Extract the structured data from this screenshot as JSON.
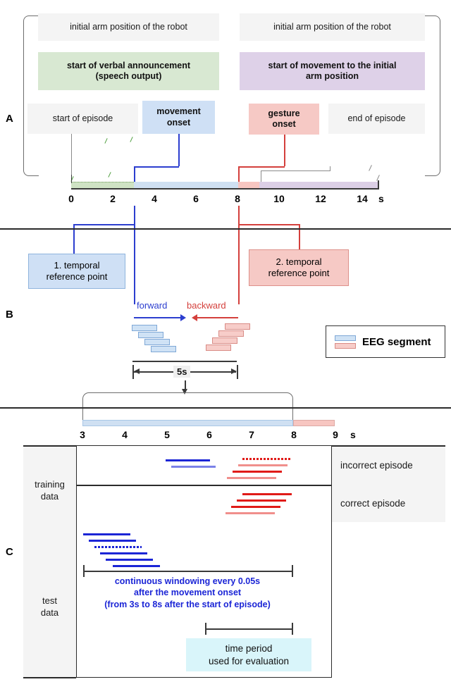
{
  "figure": {
    "panels": [
      {
        "letter": "A"
      },
      {
        "letter": "B"
      },
      {
        "letter": "C"
      }
    ]
  },
  "panel_a": {
    "boxes": {
      "initial_arm_left": "initial arm position of the robot",
      "initial_arm_right": "initial arm position of the robot",
      "speech": "start of verbal announcement\n(speech output)",
      "speech_line1": "start of verbal announcement",
      "speech_line2": "(speech output)",
      "movement_to_initial_line1": "start of movement to the initial",
      "movement_to_initial_line2": "arm position",
      "start_of_episode": "start of episode",
      "movement_onset_line1": "movement",
      "movement_onset_line2": "onset",
      "gesture_onset_line1": "gesture",
      "gesture_onset_line2": "onset",
      "end_of_episode": "end of episode"
    },
    "axis": {
      "ticks": [
        "0",
        "2",
        "4",
        "6",
        "8",
        "10",
        "12",
        "14"
      ],
      "tick_values": [
        0,
        2,
        4,
        6,
        8,
        10,
        12,
        14
      ],
      "unit": "s",
      "range": [
        0,
        15
      ]
    },
    "segments": [
      {
        "name": "speech",
        "color": "#cfe3c4",
        "start": 0,
        "end": 3
      },
      {
        "name": "movement",
        "color": "#cfe0f2",
        "start": 3,
        "end": 8
      },
      {
        "name": "gesture",
        "color": "#f7c6c1",
        "start": 8,
        "end": 9
      },
      {
        "name": "return-to-initial",
        "color": "#dccfe6",
        "start": 9,
        "end": 14.7
      }
    ],
    "markers": {
      "start_of_episode_t": 0,
      "movement_onset_t": 3,
      "gesture_onset_t": 8,
      "return_t": 9,
      "end_of_episode_t": 14.7
    }
  },
  "panel_b": {
    "ref1_line1": "1. temporal",
    "ref1_line2": "reference point",
    "ref2_line1": "2. temporal",
    "ref2_line2": "reference point",
    "forward_label": "forward",
    "backward_label": "backward",
    "legend_label": "EEG segment",
    "duration_label": "5s",
    "duration_seconds": 5,
    "ref1_time": 3,
    "ref2_time": 8
  },
  "panel_c": {
    "axis": {
      "ticks": [
        "3",
        "4",
        "5",
        "6",
        "7",
        "8",
        "9"
      ],
      "tick_values": [
        3,
        4,
        5,
        6,
        7,
        8,
        9
      ],
      "unit": "s",
      "range": [
        3,
        9
      ]
    },
    "segments": [
      {
        "name": "movement",
        "color": "#cfe0f2",
        "start": 3,
        "end": 8
      },
      {
        "name": "gesture",
        "color": "#f7c6c1",
        "start": 8,
        "end": 9
      }
    ],
    "row_labels": {
      "training_line1": "training",
      "training_line2": "data",
      "test_line1": "test",
      "test_line2": "data"
    },
    "episode_labels": {
      "incorrect": "incorrect episode",
      "correct": "correct episode"
    },
    "annotation": {
      "line1": "continuous windowing every 0.05s",
      "line2": "after the movement onset",
      "line3": "(from 3s to 8s after the start of episode)"
    },
    "eval_box": {
      "line1": "time period",
      "line2": "used for evaluation"
    }
  },
  "colors": {
    "blue_accent": "#1b25d6",
    "red_accent": "#e01b18",
    "green_fill": "#cfe3c4",
    "purple_fill": "#dccfe6",
    "blue_fill": "#cfe0f2",
    "red_fill": "#f7c6c1",
    "grey_fill": "#f4f4f4",
    "eval_fill": "#d9f5fa"
  }
}
